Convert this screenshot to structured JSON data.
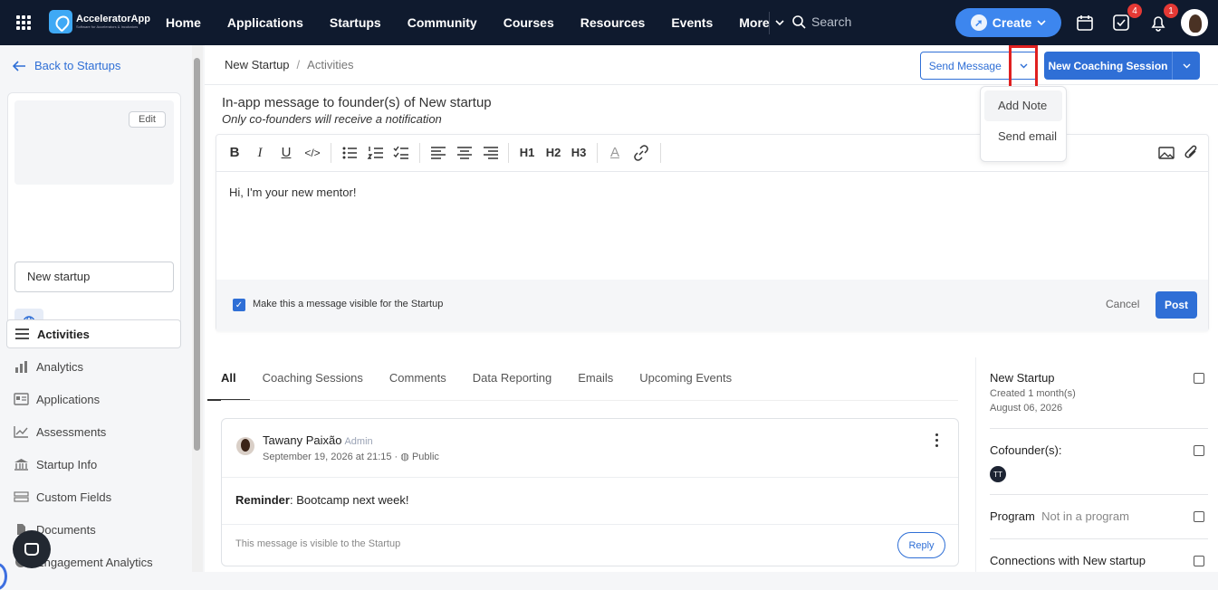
{
  "app": {
    "name": "AcceleratorApp",
    "tagline": "Software for Accelerators & Incubators"
  },
  "nav": {
    "items": [
      "Home",
      "Applications",
      "Startups",
      "Community",
      "Courses",
      "Resources",
      "Events",
      "More"
    ],
    "search_placeholder": "Search",
    "create_label": "Create",
    "tasks_badge": "4",
    "notifications_badge": "1"
  },
  "sidebar": {
    "back_label": "Back to Startups",
    "edit_label": "Edit",
    "startup_name": "New startup",
    "menu": [
      "Activities",
      "Analytics",
      "Applications",
      "Assessments",
      "Startup Info",
      "Custom Fields",
      "Documents",
      "Engagement Analytics"
    ]
  },
  "breadcrumb": {
    "parent": "New Startup",
    "separator": "/",
    "current": "Activities"
  },
  "actions": {
    "send_message": "Send Message",
    "new_coaching": "New Coaching Session",
    "dropdown": [
      "Add Note",
      "Send email"
    ]
  },
  "composer": {
    "title": "In-app message to founder(s) of New startup",
    "subtitle": "Only co-founders will receive a notification",
    "body": "Hi, I'm your new mentor!",
    "visible_checkbox_label": "Make this a message visible for the Startup",
    "cancel": "Cancel",
    "post": "Post"
  },
  "toolbar": {
    "bold": "B",
    "italic": "I",
    "underline": "U",
    "code": "</>",
    "h1": "H1",
    "h2": "H2",
    "h3": "H3",
    "font_color": "A"
  },
  "tabs": [
    "All",
    "Coaching Sessions",
    "Comments",
    "Data Reporting",
    "Emails",
    "Upcoming Events"
  ],
  "post": {
    "author": "Tawany Paixão",
    "role": "Admin",
    "date": "September 19, 2026 at 21:15",
    "visibility": "Public",
    "label": "Reminder",
    "text": ": Bootcamp next week!",
    "footer": "This message is visible to the Startup",
    "reply": "Reply"
  },
  "details": {
    "name": "New Startup",
    "created": "Created 1 month(s)",
    "date": "August 06, 2026",
    "cofounders_label": "Cofounder(s):",
    "cofounder_initials": "TT",
    "program_label": "Program",
    "program_value": "Not in a program",
    "connections_label": "Connections with New startup"
  }
}
